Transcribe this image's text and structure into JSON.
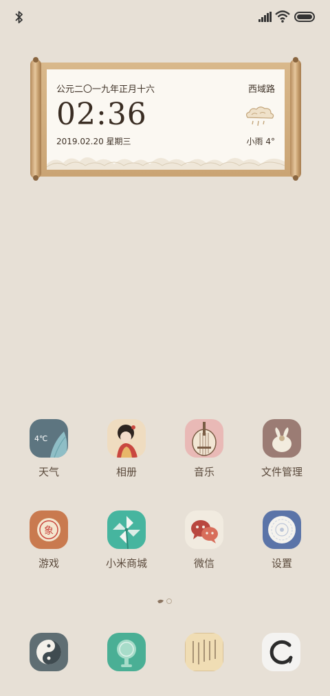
{
  "widget": {
    "lunar_date": "公元二〇一九年正月十六",
    "city": "西域路",
    "time": "02:36",
    "date": "2019.02.20 星期三",
    "weather": "小雨 4°"
  },
  "apps": [
    {
      "label": "天气",
      "icon": "weather-icon",
      "badge_text": "4℃"
    },
    {
      "label": "相册",
      "icon": "gallery-icon"
    },
    {
      "label": "音乐",
      "icon": "music-icon"
    },
    {
      "label": "文件管理",
      "icon": "file-manager-icon"
    },
    {
      "label": "游戏",
      "icon": "games-icon",
      "badge_text": "象"
    },
    {
      "label": "小米商城",
      "icon": "mi-store-icon"
    },
    {
      "label": "微信",
      "icon": "wechat-icon"
    },
    {
      "label": "设置",
      "icon": "settings-icon"
    }
  ],
  "dock": [
    {
      "icon": "phone-yinyang-icon"
    },
    {
      "icon": "messages-icon"
    },
    {
      "icon": "browser-scroll-icon"
    },
    {
      "icon": "camera-brush-icon"
    }
  ],
  "colors": {
    "background": "#e7e0d6",
    "text": "#5b4a3c",
    "scroll_rod": "#c8a170"
  }
}
